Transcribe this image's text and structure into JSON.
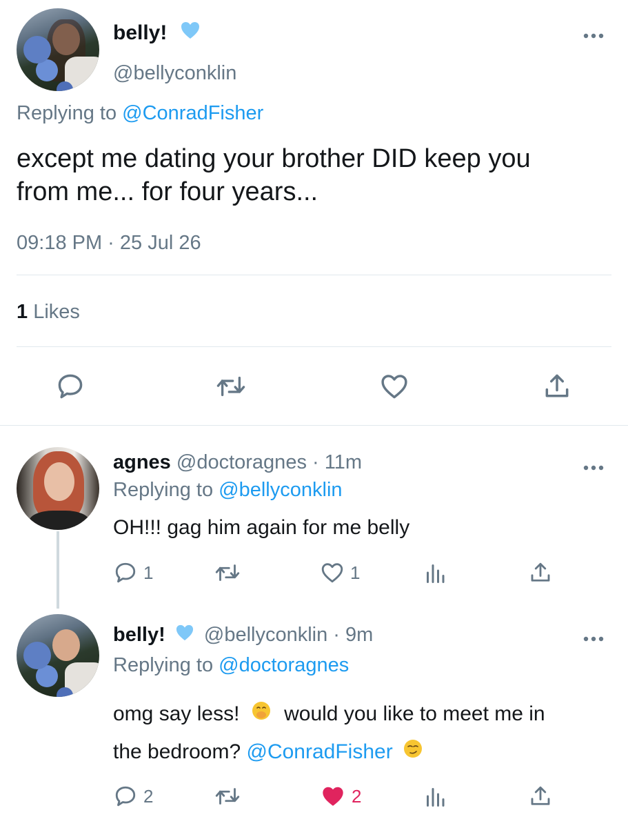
{
  "main_tweet": {
    "display_name": "belly!",
    "handle": "@bellyconklin",
    "replying_prefix": "Replying to",
    "replying_to": "@ConradFisher",
    "text_line1": "except me dating your brother DID keep you",
    "text_line2": "from me... for four years...",
    "timestamp": "09:18 PM · 25 Jul 26",
    "likes_count": "1",
    "likes_label": "Likes"
  },
  "replies": [
    {
      "display_name": "agnes",
      "handle_time": "@doctoragnes · 11m",
      "replying_prefix": "Replying to",
      "replying_to": "@bellyconklin",
      "text": "OH!!! gag him again for me belly",
      "reply_count": "1",
      "like_count": "1"
    },
    {
      "display_name": "belly!",
      "handle_time": "@bellyconklin · 9m",
      "replying_prefix": "Replying to",
      "replying_to": "@doctoragnes",
      "text_part1": "omg say less!",
      "text_part2": "would you like to meet me in",
      "text_line2_prefix": "the bedroom?",
      "mention": "@ConradFisher",
      "reply_count": "2",
      "like_count": "2"
    }
  ],
  "colors": {
    "accent": "#1d9bf0",
    "muted": "#657786",
    "like_active": "#e0245e",
    "verified": "#7fc8f8"
  },
  "icons": [
    "more-icon",
    "verified-heart-icon",
    "reply-icon",
    "retweet-icon",
    "like-icon",
    "share-icon",
    "analytics-icon",
    "hand-over-mouth-emoji",
    "smirk-emoji"
  ]
}
